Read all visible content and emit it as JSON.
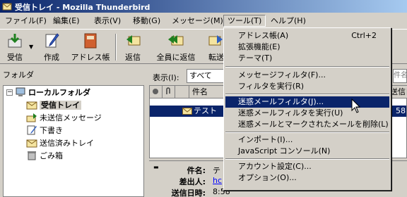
{
  "window": {
    "title": "受信トレイ - Mozilla Thunderbird"
  },
  "menubar": {
    "items": [
      "ファイル(F)",
      "編集(E)",
      "表示(V)",
      "移動(G)",
      "メッセージ(M)",
      "ツール(T)",
      "ヘルプ(H)"
    ]
  },
  "toolbar": {
    "receive": "受信",
    "compose": "作成",
    "addressbook": "アドレス帳",
    "reply": "返信",
    "reply_all": "全員に返信",
    "forward": "転送"
  },
  "folders": {
    "header": "フォルダ",
    "root": "ローカルフォルダ",
    "items": [
      "受信トレイ",
      "未送信メッセージ",
      "下書き",
      "送信済みトレイ",
      "ごみ箱"
    ]
  },
  "view": {
    "label": "表示(I):",
    "value": "すべて",
    "search_partial": "件名送信"
  },
  "message_list": {
    "col_subject": "件名",
    "col_date_partial": "送信日",
    "row_subject": "テスト",
    "row_time_partial": "58"
  },
  "preview": {
    "subject_label": "件名:",
    "subject_value": "テ",
    "from_label": "差出人:",
    "from_value": "hc",
    "date_label": "送信日時:",
    "date_value": "8:58"
  },
  "tools_menu": {
    "items": [
      {
        "label": "アドレス帳(A)",
        "shortcut": "Ctrl+2"
      },
      {
        "label": "拡張機能(E)",
        "shortcut": ""
      },
      {
        "label": "テーマ(T)",
        "shortcut": ""
      },
      {
        "label": "メッセージフィルタ(F)...",
        "shortcut": ""
      },
      {
        "label": "フィルタを実行(R)",
        "shortcut": ""
      },
      {
        "label": "迷惑メールフィルタ(J)...",
        "shortcut": ""
      },
      {
        "label": "迷惑メールフィルタを実行(U)",
        "shortcut": ""
      },
      {
        "label": "迷惑メールとマークされたメールを削除(L)",
        "shortcut": ""
      },
      {
        "label": "インポート(I)...",
        "shortcut": ""
      },
      {
        "label": "JavaScript コンソール(N)",
        "shortcut": ""
      },
      {
        "label": "アカウント設定(C)...",
        "shortcut": ""
      },
      {
        "label": "オプション(O)...",
        "shortcut": ""
      }
    ],
    "highlighted": "迷惑メールフィルタ(J)..."
  },
  "colors": {
    "selection": "#0a246a",
    "title_start": "#0a246a",
    "title_end": "#a6caf0",
    "face": "#d4d0c8"
  }
}
